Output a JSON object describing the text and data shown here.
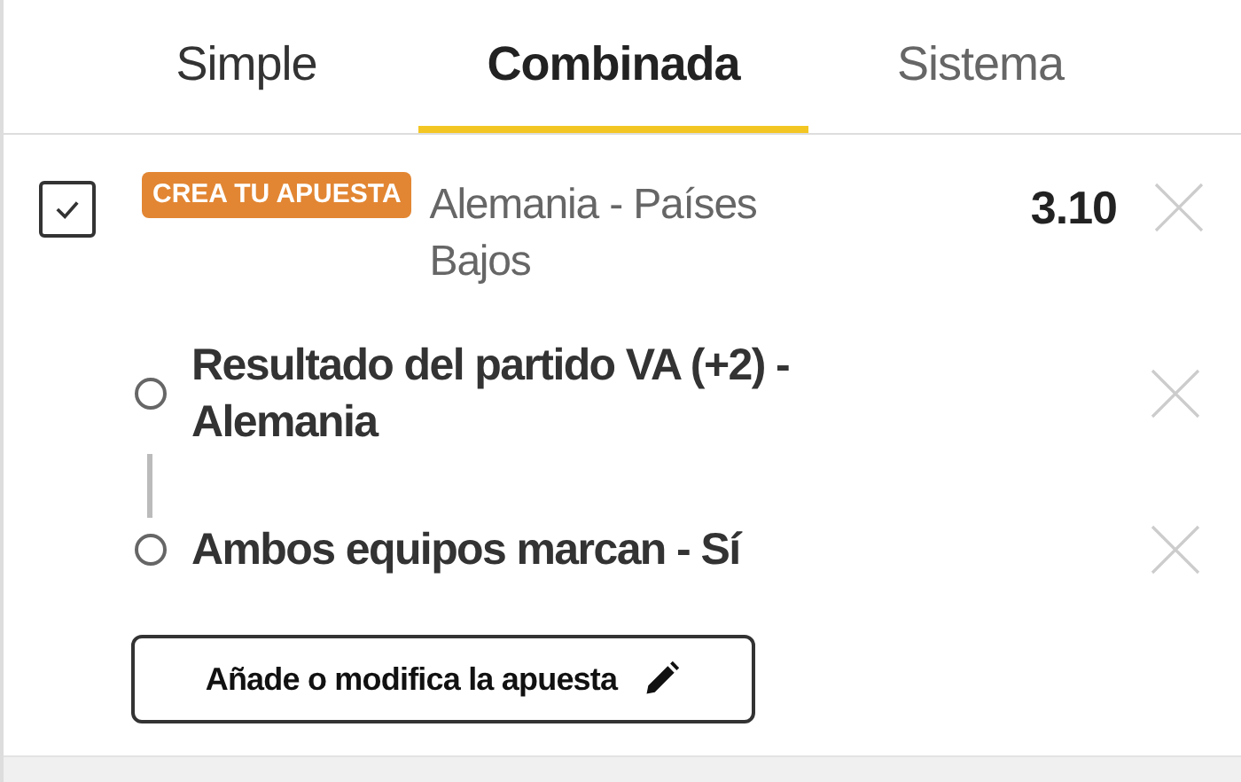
{
  "tabs": [
    {
      "label": "Simple",
      "selected": false
    },
    {
      "label": "Combinada",
      "selected": true
    },
    {
      "label": "Sistema",
      "selected": false
    }
  ],
  "bet": {
    "checked": true,
    "badge": "CREA TU APUESTA",
    "event": "Alemania - Países Bajos",
    "odds": "3.10",
    "selections": [
      {
        "label": "Resultado del partido VA (+2) - Alemania"
      },
      {
        "label": "Ambos equipos marcan - Sí"
      }
    ],
    "edit_button": "Añade o modifica la apuesta"
  }
}
